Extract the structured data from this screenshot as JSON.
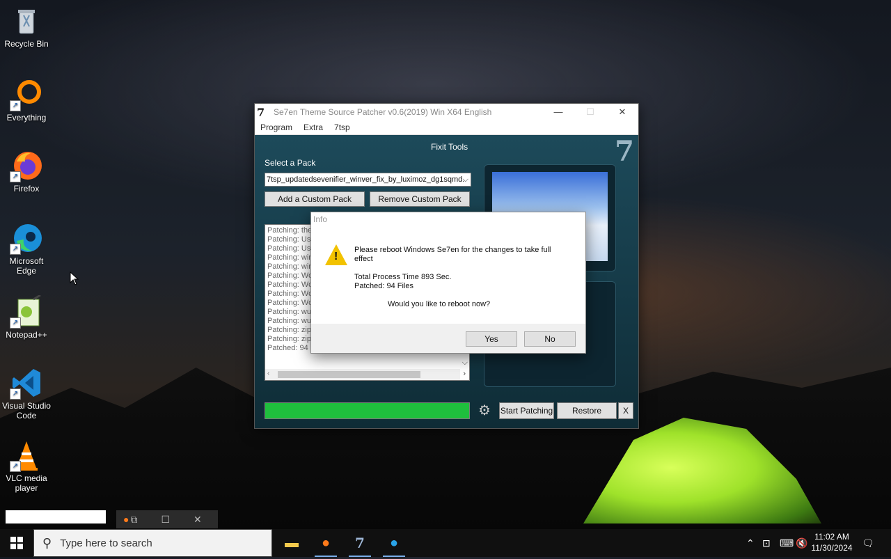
{
  "desktop": {
    "icons": [
      {
        "label": "Recycle Bin",
        "icon": "recycle-bin-icon"
      },
      {
        "label": "Everything",
        "icon": "everything-icon"
      },
      {
        "label": "Firefox",
        "icon": "firefox-icon"
      },
      {
        "label": "Microsoft Edge",
        "icon": "edge-icon"
      },
      {
        "label": "Notepad++",
        "icon": "notepadpp-icon"
      },
      {
        "label": "Visual Studio Code",
        "icon": "vscode-icon"
      },
      {
        "label": "VLC media player",
        "icon": "vlc-icon"
      }
    ]
  },
  "window": {
    "logo": "7",
    "title": "Se7en Theme Source Patcher v0.6(2019) Win X64 English",
    "controls": {
      "minimize": "—",
      "maximize": "☐",
      "close": "✕"
    },
    "menu": [
      "Program",
      "Extra",
      "7tsp"
    ],
    "section_title": "Fixit Tools",
    "corner_logo": "7",
    "select_label": "Select a Pack",
    "pack_value": "7tsp_updatedsevenifier_winver_fix_by_luximoz_dg1sqmd.",
    "add_pack": "Add a Custom Pack",
    "remove_pack": "Remove Custom Pack",
    "log_lines": [
      "Patching: the",
      "Patching: Use",
      "Patching: Use",
      "Patching: win",
      "Patching: win",
      "Patching: Wo",
      "Patching: Wo",
      "Patching: Wo",
      "Patching: Wo",
      "Patching: wu",
      "Patching: wu",
      "Patching: zipf",
      "Patching: zipf",
      "Patched: 94 I"
    ],
    "progress": 1.0,
    "start_patching": "Start Patching",
    "restore": "Restore",
    "close_x": "X"
  },
  "dialog": {
    "title": "Info",
    "message": "Please reboot Windows Se7en for the changes to take full effect",
    "process_time": "Total Process Time 893 Sec.",
    "patched": "Patched: 94 Files",
    "question": "Would you like to reboot now?",
    "yes": "Yes",
    "no": "No"
  },
  "taskbar": {
    "search_placeholder": "Type here to search",
    "time": "11:02 AM",
    "date": "11/30/2024"
  },
  "colors": {
    "progress_fill": "#1fbf3d",
    "window_bg": "#163a48",
    "taskbar_bg": "#101010"
  }
}
